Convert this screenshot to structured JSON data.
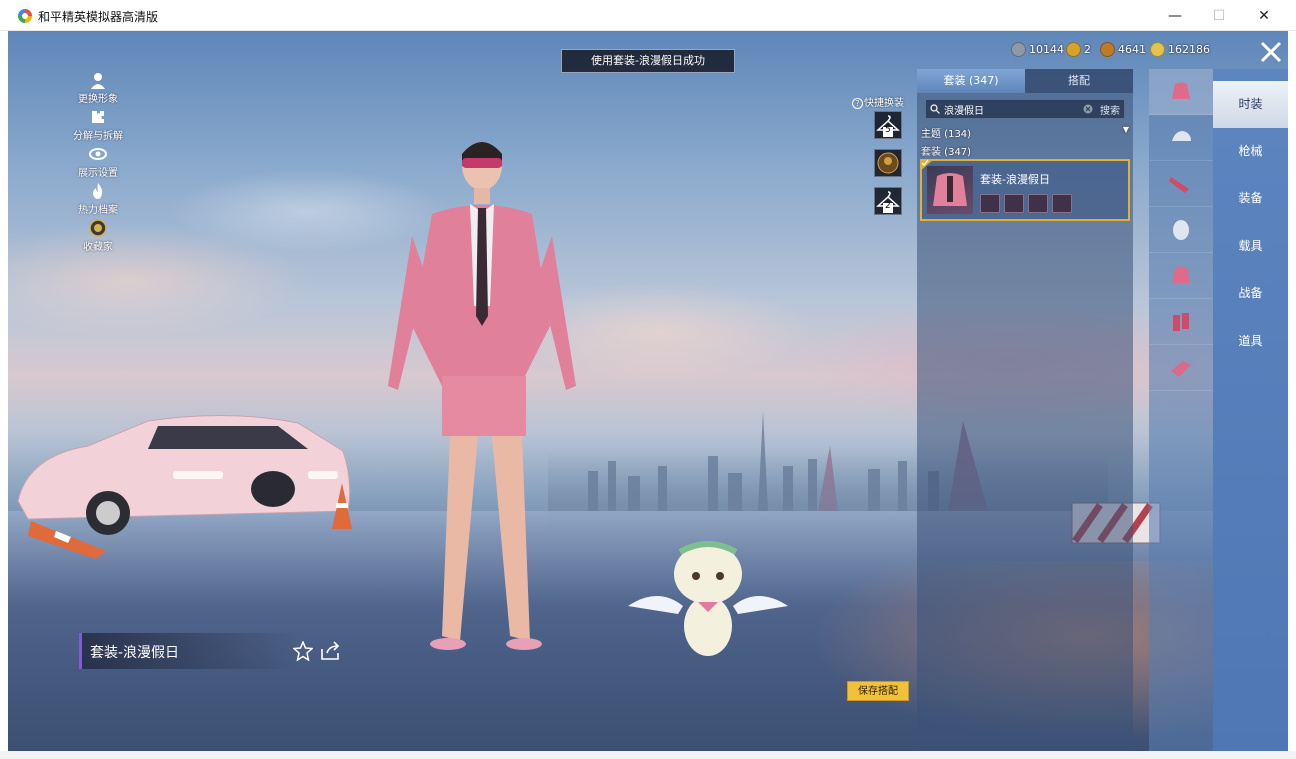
{
  "window": {
    "title": "和平精英模拟器高清版",
    "minimize": "—",
    "maximize": "☐",
    "close": "✕"
  },
  "left_menu": [
    {
      "label": "更换形象",
      "icon": "person-icon"
    },
    {
      "label": "分解与拆解",
      "icon": "puzzle-icon"
    },
    {
      "label": "展示设置",
      "icon": "eye-icon"
    },
    {
      "label": "热力档案",
      "icon": "flame-icon"
    },
    {
      "label": "收藏家",
      "icon": "collector-badge-icon"
    }
  ],
  "toast": "使用套装-浪漫假日成功",
  "currencies": [
    {
      "value": "10144",
      "color": "#8f9aa8"
    },
    {
      "value": "2",
      "color": "#d6a22a"
    },
    {
      "value": "4641",
      "color": "#c07a25"
    },
    {
      "value": "162186",
      "color": "#e6c34a"
    }
  ],
  "quick_switch": {
    "label": "快捷换装",
    "slots": [
      "5",
      "",
      "2"
    ]
  },
  "panel": {
    "tabs": [
      "套装 (347)",
      "搭配"
    ],
    "search_value": "浪漫假日",
    "search_button": "搜索",
    "theme_row": "主题 (134)",
    "set_row": "套装 (347)",
    "card_name": "套装-浪漫假日"
  },
  "icon_rail": [
    "outfit-icon",
    "hat-icon",
    "gun-skin-icon",
    "mask-icon",
    "jacket-icon",
    "pants-icon",
    "shoes-icon"
  ],
  "categories": [
    "时装",
    "枪械",
    "装备",
    "载具",
    "战备",
    "道具"
  ],
  "bottom": {
    "outfit_name": "套装-浪漫假日",
    "save_button": "保存搭配"
  },
  "colors": {
    "accent_gold": "#f2c13a",
    "selected_border": "#e2b133",
    "category_bar": "#5d85c0"
  }
}
